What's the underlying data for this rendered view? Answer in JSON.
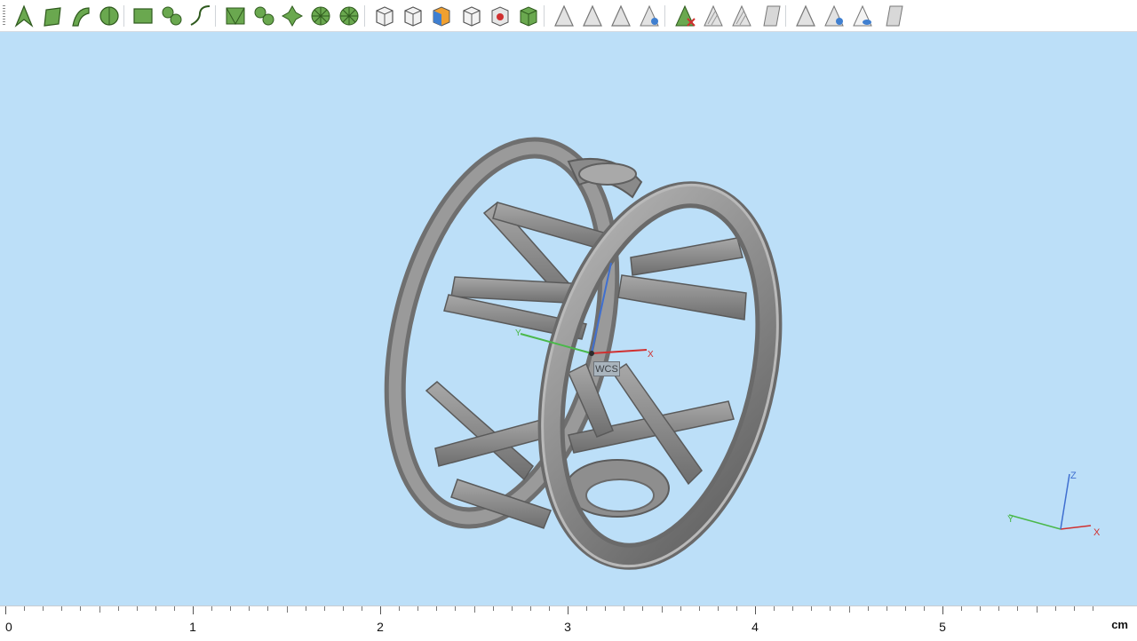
{
  "toolbar": {
    "buttons": [
      {
        "name": "select-icon",
        "tooltip": "Select"
      },
      {
        "name": "select-face-icon",
        "tooltip": "Select face"
      },
      {
        "name": "select-edge-icon",
        "tooltip": "Select edge"
      },
      {
        "name": "select-volume-icon",
        "tooltip": "Select volume"
      },
      {
        "name": "rectangle-select-icon",
        "tooltip": "Rectangle"
      },
      {
        "name": "spline-select-icon",
        "tooltip": "Spline"
      },
      {
        "name": "curve-select-icon",
        "tooltip": "Curve"
      },
      {
        "name": "mesh-face-icon",
        "tooltip": "Mesh face"
      },
      {
        "name": "mesh-blob-icon",
        "tooltip": "Mesh blob"
      },
      {
        "name": "mesh-cross-icon",
        "tooltip": "Mesh cross"
      },
      {
        "name": "mesh-wheel-icon",
        "tooltip": "Mesh wheel"
      },
      {
        "name": "mesh-fan-icon",
        "tooltip": "Mesh fan"
      },
      {
        "name": "cube-select-icon",
        "tooltip": "Cube select"
      },
      {
        "name": "cube-face-icon",
        "tooltip": "Cube face"
      },
      {
        "name": "cube-color-icon",
        "tooltip": "Cube color"
      },
      {
        "name": "cube-outline-icon",
        "tooltip": "Cube outline"
      },
      {
        "name": "cube-record-icon",
        "tooltip": "Cube record"
      },
      {
        "name": "cube-green-icon",
        "tooltip": "Cube green"
      },
      {
        "name": "pick-point-icon",
        "tooltip": "Pick point"
      },
      {
        "name": "pick-edge-icon",
        "tooltip": "Pick edge"
      },
      {
        "name": "pick-face-icon",
        "tooltip": "Pick face"
      },
      {
        "name": "pick-color-icon",
        "tooltip": "Pick colored"
      },
      {
        "name": "delete-pick-icon",
        "tooltip": "Delete"
      },
      {
        "name": "hatch-pick-icon",
        "tooltip": "Hatch"
      },
      {
        "name": "copy-pick-icon",
        "tooltip": "Copy"
      },
      {
        "name": "shade-pick-icon",
        "tooltip": "Shade"
      },
      {
        "name": "view-pick-icon",
        "tooltip": "View"
      },
      {
        "name": "view-multi-icon",
        "tooltip": "View multiple"
      },
      {
        "name": "view-eye-icon",
        "tooltip": "View eye"
      },
      {
        "name": "view-frame-icon",
        "tooltip": "View frame"
      }
    ]
  },
  "viewport": {
    "wcs_label": "WCS",
    "wcs_axes": {
      "x": "X",
      "y": "Y"
    },
    "triad_axes": {
      "x": "X",
      "y": "Y",
      "z": "Z"
    },
    "colors": {
      "background": "#bcdff8",
      "x_axis": "#d03030",
      "y_axis": "#4ab84a",
      "z_axis": "#3f6fd0",
      "model": "#8d8d8d"
    }
  },
  "ruler": {
    "labels": [
      "0",
      "1",
      "2",
      "3",
      "4",
      "5"
    ],
    "unit": "cm"
  }
}
